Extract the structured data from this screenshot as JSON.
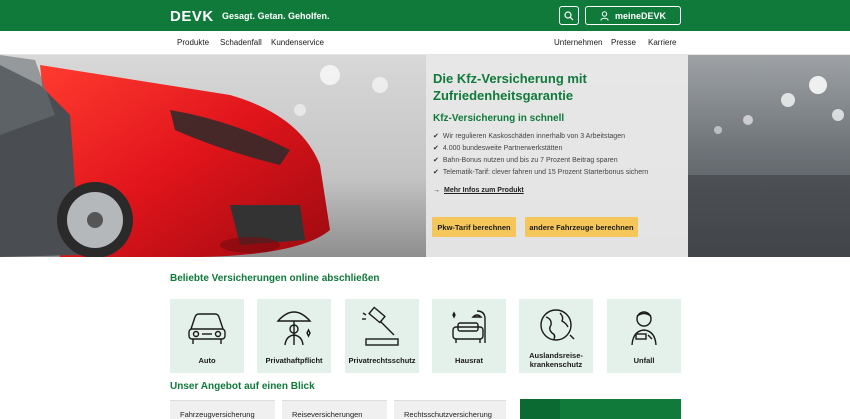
{
  "header": {
    "logo": "DEVK",
    "slogan": "Gesagt. Getan. Geholfen.",
    "account_label": "meineDEVK"
  },
  "nav": {
    "left": [
      "Produkte",
      "Schadenfall",
      "Kundenservice"
    ],
    "right": [
      "Unternehmen",
      "Presse",
      "Karriere"
    ]
  },
  "hero": {
    "title": "Die Kfz-Versicherung mit Zufriedenheitsgarantie",
    "subtitle": "Kfz-Versicherung in schnell",
    "benefits": [
      "Wir regulieren Kaskoschäden innerhalb von 3 Arbeitstagen",
      "4.000 bundesweite Partnerwerkstätten",
      "Bahn-Bonus nutzen und bis zu 7 Prozent Beitrag sparen",
      "Telematik-Tarif: clever fahren und 15 Prozent Starterbonus sichern"
    ],
    "more_link": "Mehr Infos zum Produkt",
    "btn_primary": "Pkw-Tarif berechnen",
    "btn_secondary": "andere Fahrzeuge berechnen"
  },
  "popular": {
    "title": "Beliebte Versicherungen online abschließen",
    "tiles": [
      {
        "label": "Auto",
        "icon": "car-icon"
      },
      {
        "label": "Privathaftpflicht",
        "icon": "umbrella-person-icon"
      },
      {
        "label": "Privatrechtsschutz",
        "icon": "gavel-icon"
      },
      {
        "label": "Hausrat",
        "icon": "sofa-lamp-icon"
      },
      {
        "label": "Auslandsreise-krankenschutz",
        "icon": "globe-icon"
      },
      {
        "label": "Unfall",
        "icon": "bandaged-person-icon"
      }
    ]
  },
  "offer": {
    "title": "Unser Angebot auf einen Blick",
    "cards": [
      "Fahrzeugversicherung",
      "Reiseversicherungen",
      "Rechtsschutzversicherung"
    ]
  },
  "colors": {
    "brand_green": "#0f7a3a",
    "tile_bg": "#e4f1ea",
    "button_yellow": "#f5c75a"
  }
}
